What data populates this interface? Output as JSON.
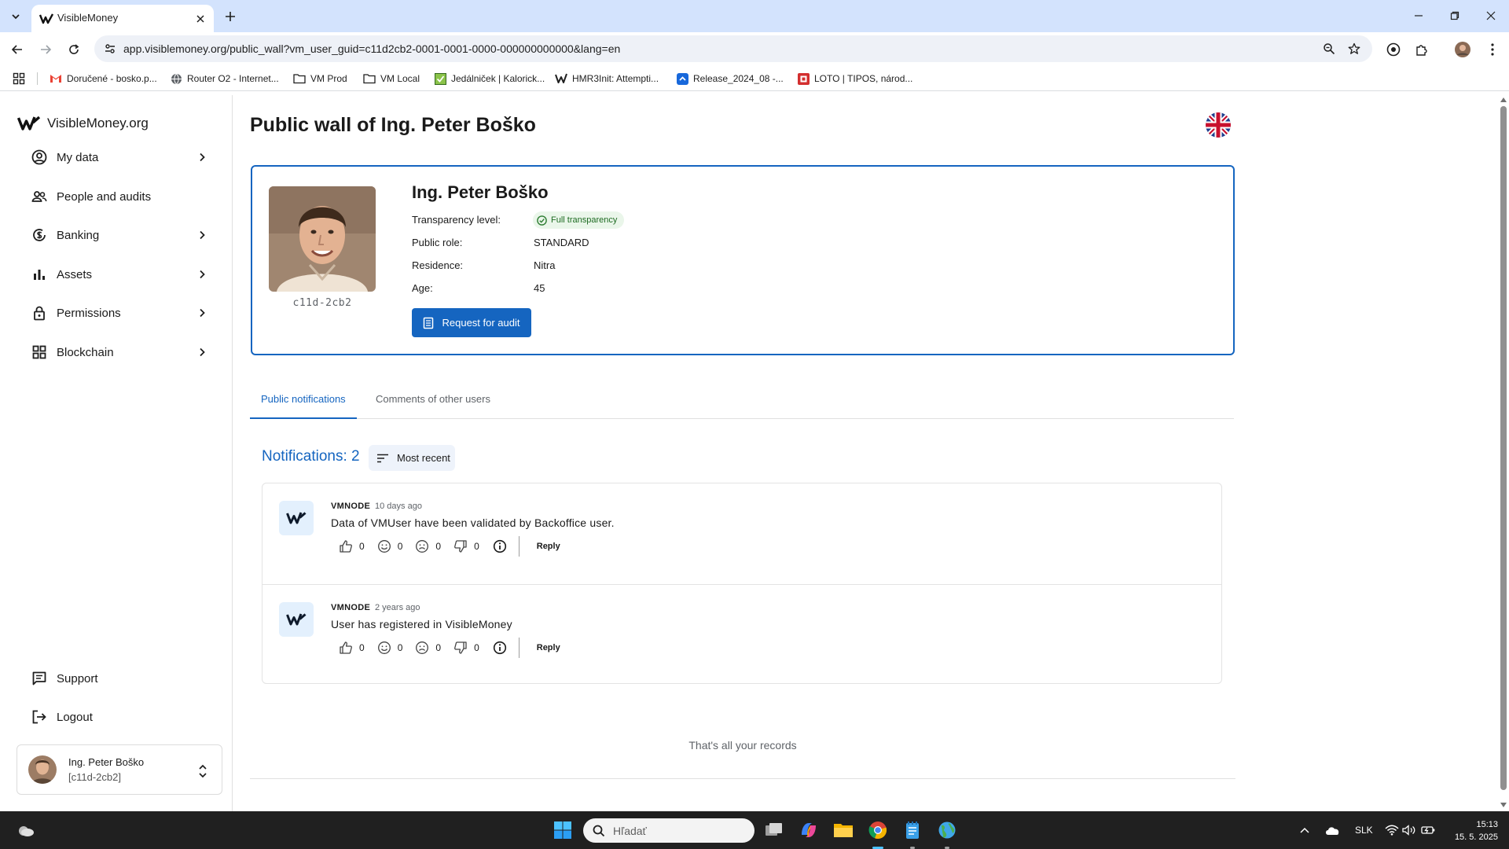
{
  "browser": {
    "tab_title": "VisibleMoney",
    "url": "app.visiblemoney.org/public_wall?vm_user_guid=c11d2cb2-0001-0001-0000-000000000000&lang=en",
    "bookmarks": [
      {
        "label": "Doručené - bosko.p...",
        "icon": "gmail-icon"
      },
      {
        "label": "Router O2 - Internet...",
        "icon": "globe-icon"
      },
      {
        "label": "VM Prod",
        "icon": "folder-icon"
      },
      {
        "label": "VM Local",
        "icon": "folder-icon"
      },
      {
        "label": "Jedálniček | Kalorick...",
        "icon": "kaloricke-icon"
      },
      {
        "label": "HMR3Init: Attempti...",
        "icon": "vm-icon"
      },
      {
        "label": "Release_2024_08 -...",
        "icon": "jira-icon"
      },
      {
        "label": "LOTO | TIPOS, národ...",
        "icon": "tipos-icon"
      }
    ]
  },
  "sidebar": {
    "logo_text": "VisibleMoney.org",
    "items": [
      {
        "label": "My data",
        "icon": "account-circle-icon",
        "has_submenu": true
      },
      {
        "label": "People and audits",
        "icon": "people-icon",
        "has_submenu": false
      },
      {
        "label": "Banking",
        "icon": "banking-icon",
        "has_submenu": true
      },
      {
        "label": "Assets",
        "icon": "bar-chart-icon",
        "has_submenu": true
      },
      {
        "label": "Permissions",
        "icon": "lock-icon",
        "has_submenu": true
      },
      {
        "label": "Blockchain",
        "icon": "grid-icon",
        "has_submenu": true
      }
    ],
    "bottom_items": [
      {
        "label": "Support",
        "icon": "chat-icon"
      },
      {
        "label": "Logout",
        "icon": "logout-icon"
      }
    ],
    "user": {
      "name": "Ing. Peter Boško",
      "id": "[c11d-2cb2]"
    }
  },
  "main": {
    "title": "Public wall of Ing. Peter Boško",
    "profile": {
      "photo_code": "c11d-2cb2",
      "name": "Ing. Peter Boško",
      "fields": [
        {
          "label": "Transparency level:",
          "value": "Full transparency",
          "badge": true
        },
        {
          "label": "Public role:",
          "value": "STANDARD"
        },
        {
          "label": "Residence:",
          "value": "Nitra"
        },
        {
          "label": "Age:",
          "value": "45"
        }
      ],
      "audit_button": "Request for audit"
    },
    "tabs": [
      {
        "label": "Public notifications",
        "active": true
      },
      {
        "label": "Comments of other users",
        "active": false
      }
    ],
    "notifications_count": "Notifications: 2",
    "sort_label": "Most recent",
    "notifications": [
      {
        "author": "VMNODE",
        "time": "10 days ago",
        "text": "Data of VMUser have been validated by Backoffice user.",
        "reactions": {
          "like": "0",
          "smile": "0",
          "sad": "0",
          "dislike": "0"
        },
        "reply": "Reply"
      },
      {
        "author": "VMNODE",
        "time": "2 years ago",
        "text": "User has registered in VisibleMoney",
        "reactions": {
          "like": "0",
          "smile": "0",
          "sad": "0",
          "dislike": "0"
        },
        "reply": "Reply"
      }
    ],
    "end_note": "That's all your records"
  },
  "taskbar": {
    "search_placeholder": "Hľadať",
    "language": "SLK",
    "time": "15:13",
    "date": "15. 5. 2025"
  },
  "colors": {
    "accent": "#1565c0",
    "badge_bg": "#eaf6ea",
    "badge_text": "#1e6b22"
  }
}
